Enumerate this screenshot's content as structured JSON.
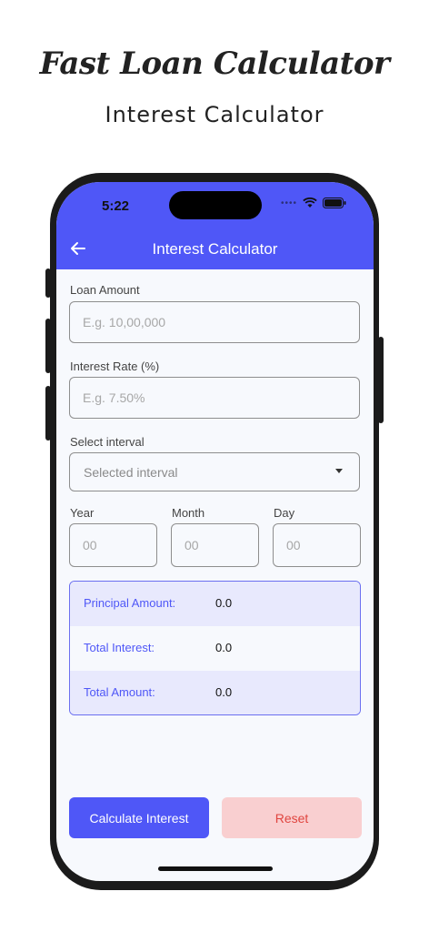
{
  "promo": {
    "title": "Fast Loan Calculator",
    "subtitle": "Interest Calculator"
  },
  "status_bar": {
    "time": "5:22",
    "icons": [
      "signal-dots-icon",
      "wifi-icon",
      "battery-icon"
    ]
  },
  "appbar": {
    "title": "Interest Calculator",
    "back_icon": "arrow-left-icon",
    "color": "#4f57f7"
  },
  "form": {
    "loan_amount": {
      "label": "Loan Amount",
      "placeholder": "E.g. 10,00,000",
      "value": ""
    },
    "interest_rate": {
      "label": "Interest Rate (%)",
      "placeholder": "E.g. 7.50%",
      "value": ""
    },
    "interval": {
      "label": "Select interval",
      "selected": "Selected interval"
    },
    "year": {
      "label": "Year",
      "placeholder": "00"
    },
    "month": {
      "label": "Month",
      "placeholder": "00"
    },
    "day": {
      "label": "Day",
      "placeholder": "00"
    }
  },
  "summary": {
    "principal": {
      "label": "Principal Amount:",
      "value": "0.0"
    },
    "total_interest": {
      "label": "Total Interest:",
      "value": "0.0"
    },
    "total_amount": {
      "label": "Total Amount:",
      "value": "0.0"
    }
  },
  "actions": {
    "calculate_label": "Calculate Interest",
    "reset_label": "Reset"
  },
  "colors": {
    "accent": "#4f57f7",
    "reset_bg": "#f9cfd0",
    "reset_text": "#e0453f",
    "summary_band": "#e8e9fd"
  }
}
